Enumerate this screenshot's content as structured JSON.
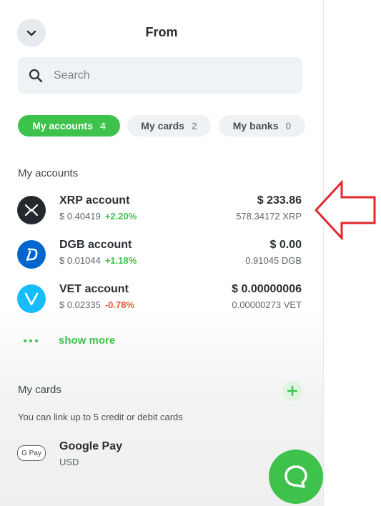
{
  "header": {
    "title": "From"
  },
  "search": {
    "placeholder": "Search"
  },
  "tabs": [
    {
      "label": "My accounts",
      "count": "4",
      "active": true
    },
    {
      "label": "My cards",
      "count": "2",
      "active": false
    },
    {
      "label": "My banks",
      "count": "0",
      "active": false
    }
  ],
  "accounts_section": {
    "title": "My accounts",
    "items": [
      {
        "name": "XRP account",
        "price": "$ 0.40419",
        "change": "+2.20%",
        "trend": "up",
        "balance": "$ 233.86",
        "amount": "578.34172 XRP",
        "icon": "xrp-icon",
        "color": "#23292f"
      },
      {
        "name": "DGB account",
        "price": "$ 0.01044",
        "change": "+1.18%",
        "trend": "up",
        "balance": "$ 0.00",
        "amount": "0.91045 DGB",
        "icon": "digibyte-icon",
        "color": "#0066cc"
      },
      {
        "name": "VET account",
        "price": "$ 0.02335",
        "change": "-0.78%",
        "trend": "down",
        "balance": "$ 0.00000006",
        "amount": "0.00000273 VET",
        "icon": "vechain-icon",
        "color": "#15bdff"
      }
    ],
    "show_more": "show more"
  },
  "cards_section": {
    "title": "My cards",
    "hint": "You can link up to 5 credit or debit cards",
    "items": [
      {
        "name": "Google Pay",
        "currency": "USD",
        "logo_text": "G Pay"
      }
    ]
  },
  "colors": {
    "accent": "#3ec24c",
    "negative": "#e2542f",
    "annotation_arrow": "#e4272b"
  }
}
